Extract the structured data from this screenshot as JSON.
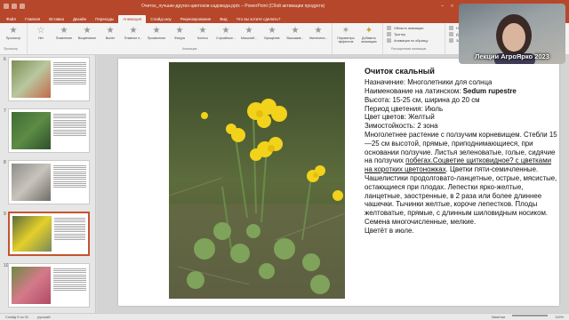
{
  "window": {
    "title": "Очиток_лучшие-других-цветоков-садовода.pptx – PowerPoint (Сбой активации продукта)"
  },
  "ribbon_tabs": [
    "Файл",
    "Главная",
    "Вставка",
    "Дизайн",
    "Переходы",
    "Анимация",
    "Слайд-шоу",
    "Рецензирование",
    "Вид",
    "Что вы хотите сделать?"
  ],
  "active_tab_index": 5,
  "ribbon": {
    "preview_label": "Просмотр",
    "preview_group": "Просмотр",
    "animations": [
      "Нет",
      "Появление",
      "Выцветание",
      "Вылет",
      "Плавное п...",
      "Проявление",
      "Фигура",
      "Колесо",
      "Случайные...",
      "Масштаб...",
      "Вращение",
      "Выскакив...",
      "Увеличени..."
    ],
    "animation_group": "Анимация",
    "effect_params": "Параметры эффектов",
    "add_animation": "Добавить анимацию",
    "advanced_group": "Расширенная анимация",
    "side_items": [
      "Область анимации",
      "Триггер",
      "Анимация по образцу"
    ],
    "timing_items": [
      "Начало:",
      "Длительность:",
      "Задержка:"
    ]
  },
  "slides_panel": {
    "slides": [
      {
        "num": "6",
        "colors": [
          "#7d8f52",
          "#b9c7a0",
          "#c46a4a"
        ],
        "selected": false
      },
      {
        "num": "7",
        "colors": [
          "#3f6b34",
          "#5c8c45",
          "#2f4f2a"
        ],
        "selected": false
      },
      {
        "num": "8",
        "colors": [
          "#8c8e88",
          "#c9c3bd",
          "#6e6d66"
        ],
        "selected": false
      },
      {
        "num": "9",
        "colors": [
          "#5c6c3e",
          "#e5cf2a",
          "#7a8a5a"
        ],
        "selected": true
      },
      {
        "num": "10",
        "colors": [
          "#6c8a44",
          "#d47a8a",
          "#b24a66"
        ],
        "selected": false
      }
    ]
  },
  "slide": {
    "heading": "Очиток скальный",
    "lines": [
      "Назначение: Многолетники для солнца",
      "Высота: 15-25 см, ширина до 20 см",
      "Период цветения: Июль",
      "Цвет цветов: Желтый",
      "Зимостойкость: 2 зона"
    ],
    "latin_prefix": "Наименование на латинском: ",
    "latin_name": "Sedum rupestre",
    "description_1": "Многолетнее растение с ползучим корневищем. Стебли 15—25 см высотой, прямые, приподнимающиеся, при основании ползучие. Листья зеленоватые, голые, сидячие на ползучих ",
    "description_link": "побегах.Соцветие щитковидное? с цветками на коротких цветоножках",
    "description_2": ". Цветки пяти-семичленные. Чашелистики продолговато-ланцетные, острые, мясистые, остающиеся при плодах. Лепестки ярко-желтые, ланцетные, заостренные, в 2 раза или более длиннее чашечки. Тычинки желтые, короче лепестков. Плоды желтоватые, прямые, с длинным шиловидным носиком. Семена многочисленные, мелкие.",
    "description_3": "Цветёт в июле."
  },
  "status": {
    "slide_counter": "Слайд 9 из 31",
    "language": "русский",
    "notes": "Заметки",
    "zoom": "119%"
  },
  "webcam": {
    "caption": "Лекции АгроЯрко 2023"
  }
}
